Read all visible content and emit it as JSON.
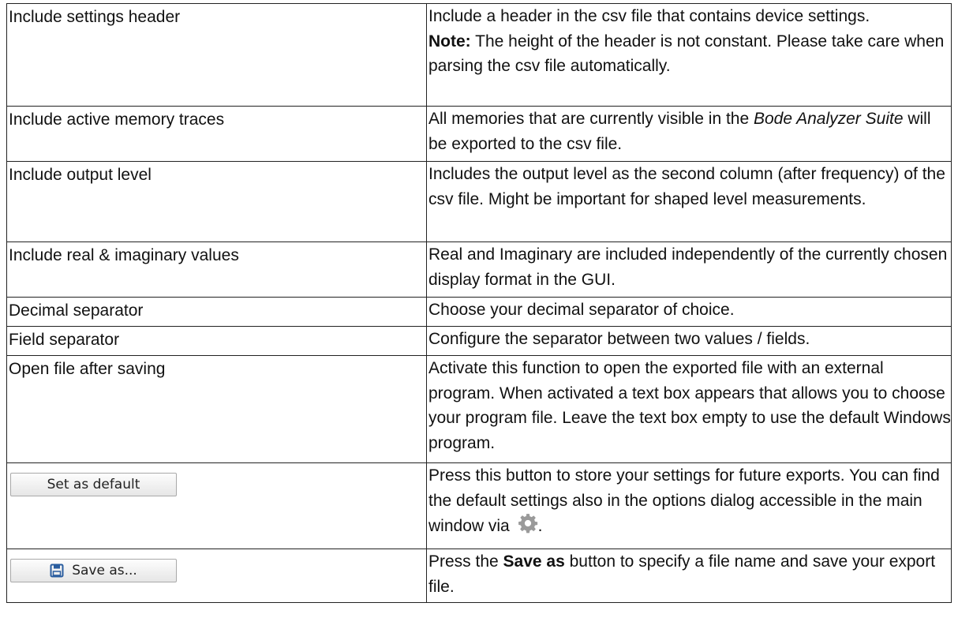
{
  "rows": [
    {
      "label": "Include settings header",
      "desc_1": "Include a header in the csv file that contains device settings.",
      "note_label": "Note:",
      "note_text": " The height of the header is not constant. Please take care when parsing the csv file automatically."
    },
    {
      "label": "Include active memory traces",
      "desc_1": "All memories that are currently visible in the ",
      "desc_ital": "Bode Analyzer  Suite",
      "desc_2": " will be exported to the csv file."
    },
    {
      "label": "Include output level",
      "desc": "Includes the output level as the second column (after frequency) of the csv file. Might be important for shaped level measurements."
    },
    {
      "label": "Include real & imaginary values",
      "desc": "Real and Imaginary are included independently of the currently chosen display format in the GUI."
    },
    {
      "label": "Decimal separator",
      "desc": "Choose your decimal separator of choice."
    },
    {
      "label": "Field separator",
      "desc": "Configure the separator between two values / fields."
    },
    {
      "label": "Open file after saving",
      "desc": "Activate this function to open the exported file with an external program. When activated a text box appears that allows you to choose your program file. Leave the text box empty to use the default Windows program."
    },
    {
      "button_label": "Set as default",
      "desc_1": "Press this button to store your settings for future exports. You can find the default settings also in the options dialog accessible in the main window via ",
      "desc_end": "."
    },
    {
      "button_label": "Save as...",
      "button_icon": "floppy-disk-icon",
      "desc_1": "Press the ",
      "desc_bold": "Save as",
      "desc_2": " button to specify a file name and save your export file."
    }
  ],
  "colors": {
    "border": "#222222",
    "button_bg": "#e6e6e6",
    "accent_icon": "#2a5d9f",
    "gear_icon": "#9a9a9a"
  }
}
